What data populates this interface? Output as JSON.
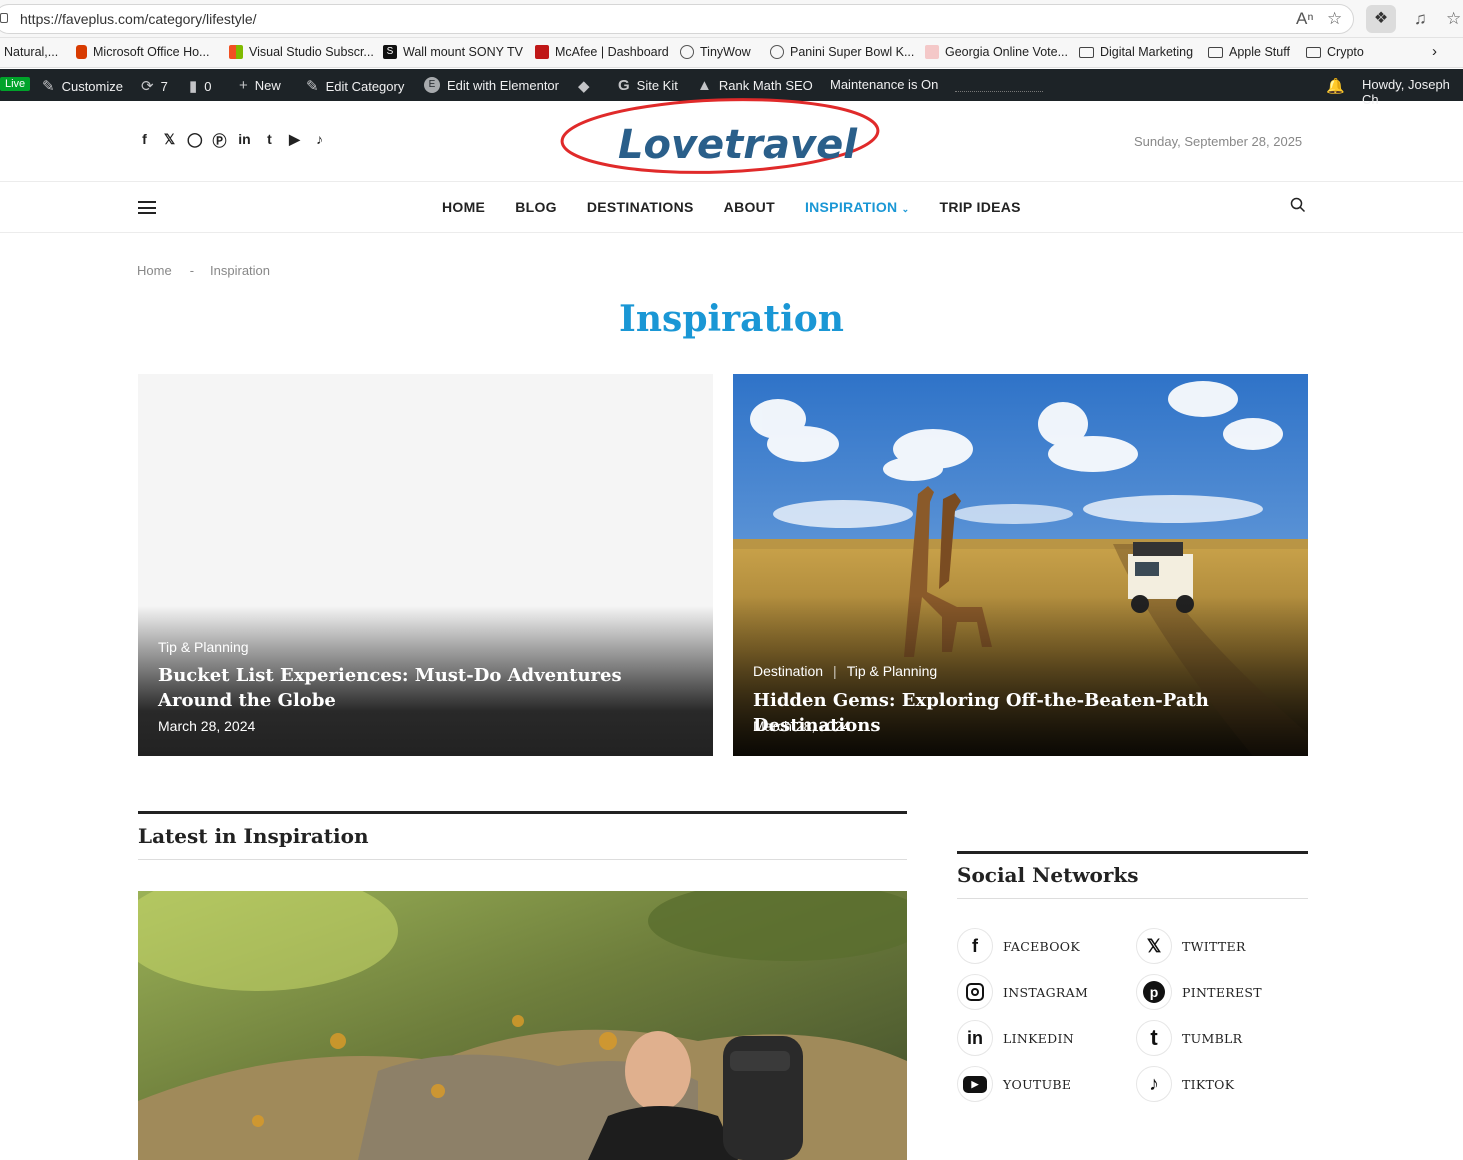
{
  "browser": {
    "url": "https://faveplus.com/category/lifestyle/",
    "bookmarks": [
      {
        "label": "Natural,...",
        "icon": "page-icon",
        "color": "#ffffff"
      },
      {
        "label": "Microsoft Office Ho...",
        "icon": "office-icon",
        "color": "#d83b01"
      },
      {
        "label": "Visual Studio Subscr...",
        "icon": "windows-icon",
        "color": "#00a4ef"
      },
      {
        "label": "Wall mount SONY TV",
        "icon": "s-icon",
        "color": "#111111"
      },
      {
        "label": "McAfee | Dashboard",
        "icon": "mcafee-icon",
        "color": "#c01818"
      },
      {
        "label": "TinyWow",
        "icon": "globe-icon",
        "color": "#555555"
      },
      {
        "label": "Panini Super Bowl K...",
        "icon": "globe-icon",
        "color": "#555555"
      },
      {
        "label": "Georgia Online Vote...",
        "icon": "page-icon",
        "color": "#f4b8b8"
      },
      {
        "label": "Digital Marketing",
        "icon": "folder-icon",
        "color": "#444444"
      },
      {
        "label": "Apple Stuff",
        "icon": "folder-icon",
        "color": "#444444"
      },
      {
        "label": "Crypto",
        "icon": "folder-icon",
        "color": "#444444"
      }
    ]
  },
  "wp_admin": {
    "live": "Live",
    "customize": "Customize",
    "updates": "7",
    "comments": "0",
    "new": "New",
    "edit_category": "Edit Category",
    "elementor": "Edit with Elementor",
    "site_kit": "Site Kit",
    "rank_math": "Rank Math SEO",
    "maintenance": "Maintenance is On",
    "howdy": "Howdy, Joseph Ch"
  },
  "site": {
    "logo_text": "Lovetravel",
    "date": "Sunday, September 28, 2025",
    "nav": [
      "Home",
      "Blog",
      "Destinations",
      "About",
      "Inspiration",
      "Trip Ideas"
    ],
    "active_nav": "Inspiration",
    "accent": "#1a97d5"
  },
  "breadcrumb": {
    "home": "Home",
    "sep": "-",
    "current": "Inspiration"
  },
  "page_title": "Inspiration",
  "featured": [
    {
      "categories": [
        "Tip & Planning"
      ],
      "title": "Bucket List Experiences: Must-Do Adventures Around the Globe",
      "date": "March 28, 2024"
    },
    {
      "categories": [
        "Destination",
        "Tip & Planning"
      ],
      "title": "Hidden Gems: Exploring Off-the-Beaten-Path Destinations",
      "date": "March 28, 2024"
    }
  ],
  "latest_heading": "Latest in Inspiration",
  "social_heading": "Social Networks",
  "social_networks": [
    {
      "label": "Facebook",
      "icon": "facebook-icon"
    },
    {
      "label": "Twitter",
      "icon": "x-icon"
    },
    {
      "label": "Instagram",
      "icon": "instagram-icon"
    },
    {
      "label": "Pinterest",
      "icon": "pinterest-icon"
    },
    {
      "label": "LinkedIn",
      "icon": "linkedin-icon"
    },
    {
      "label": "Tumblr",
      "icon": "tumblr-icon"
    },
    {
      "label": "YouTube",
      "icon": "youtube-icon"
    },
    {
      "label": "TikTok",
      "icon": "tiktok-icon"
    }
  ]
}
